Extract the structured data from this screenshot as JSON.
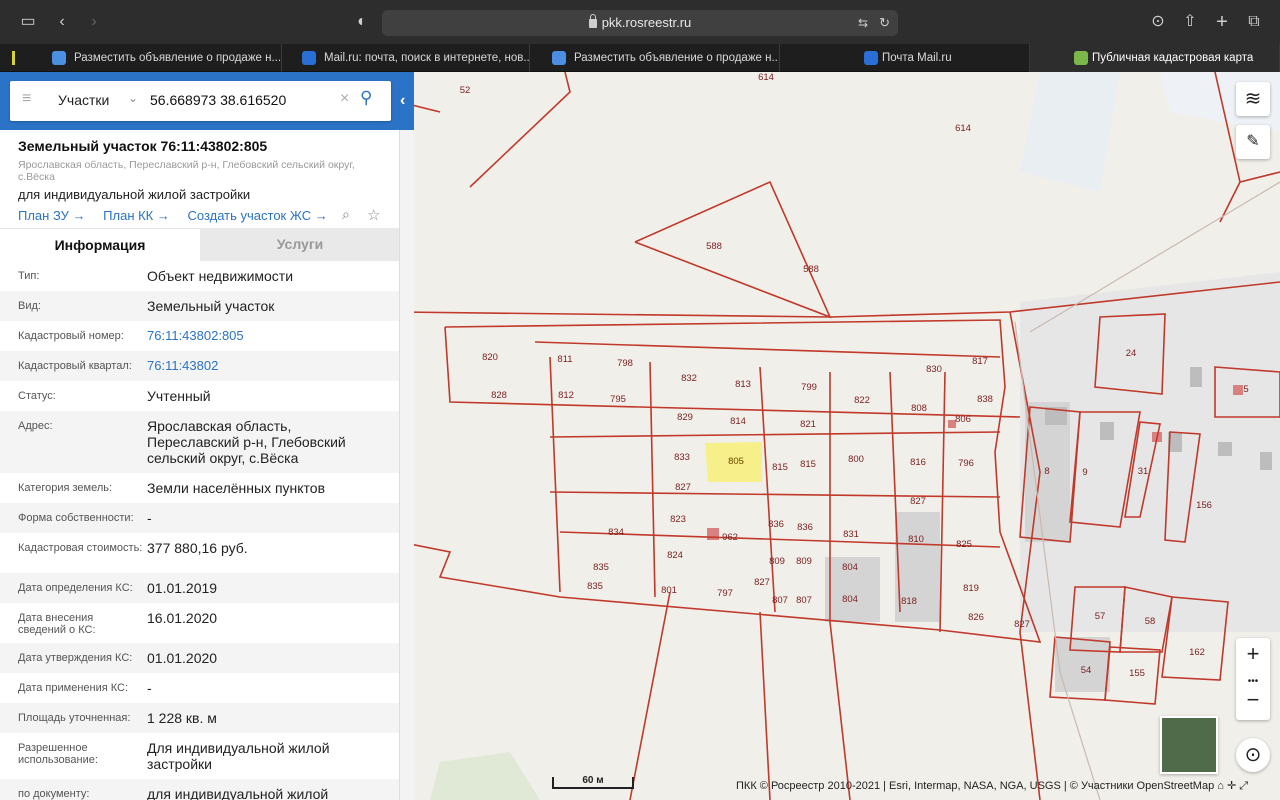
{
  "browser": {
    "url": "pkk.rosreestr.ru",
    "tabs": [
      {
        "title": "Разместить объявление о продаже н...",
        "active": false
      },
      {
        "title": "Mail.ru: почта, поиск в интернете, нов...",
        "active": false
      },
      {
        "title": "Разместить объявление о продаже н...",
        "active": false
      },
      {
        "title": "Почта Mail.ru",
        "active": false
      },
      {
        "title": "Публичная кадастровая карта",
        "active": true
      }
    ]
  },
  "search": {
    "type_label": "Участки",
    "query": "56.668973 38.616520"
  },
  "parcel": {
    "title": "Земельный участок 76:11:43802:805",
    "address_short": "Ярославская область, Переславский р-н, Глебовский сельский округ, с.Вёска",
    "purpose": "для индивидуальной жилой застройки",
    "links": [
      "План ЗУ →",
      "План КК →",
      "Создать участок ЖС →"
    ]
  },
  "info_tabs": [
    "Информация",
    "Услуги"
  ],
  "fields": [
    {
      "k": "Тип:",
      "v": "Объект недвижимости"
    },
    {
      "k": "Вид:",
      "v": "Земельный участок"
    },
    {
      "k": "Кадастровый номер:",
      "v": "76:11:43802:805",
      "link": true
    },
    {
      "k": "Кадастровый квартал:",
      "v": "76:11:43802",
      "link": true
    },
    {
      "k": "Статус:",
      "v": "Учтенный"
    },
    {
      "k": "Адрес:",
      "v": "Ярославская область, Переславский р-н, Глебовский сельский округ, с.Вёска"
    },
    {
      "k": "Категория земель:",
      "v": "Земли населённых пунктов"
    },
    {
      "k": "Форма собственности:",
      "v": "-"
    },
    {
      "k": "Кадастровая стоимость:",
      "v": "377 880,16 руб."
    },
    {
      "k": "Дата определения КС:",
      "v": "01.01.2019"
    },
    {
      "k": "Дата внесения сведений о КС:",
      "v": "16.01.2020"
    },
    {
      "k": "Дата утверждения КС:",
      "v": "01.01.2020"
    },
    {
      "k": "Дата применения КС:",
      "v": "-"
    },
    {
      "k": "Площадь уточненная:",
      "v": "1 228 кв. м"
    },
    {
      "k": "Разрешенное использование:",
      "v": "Для индивидуальной жилой застройки"
    },
    {
      "k": "по документу:",
      "v": "для индивидуальной жилой"
    }
  ],
  "map": {
    "scale_label": "60 м",
    "attribution": "ПКК © Росреестр 2010-2021 | Esri, Intermap, NASA, NGA, USGS | © Участники OpenStreetMap",
    "zoom_in": "+",
    "zoom_out": "−",
    "more": "•••",
    "highlight_color": "#f7f08a",
    "boundary_color": "#c0392b",
    "parcel_labels": [
      "614",
      "52",
      "614",
      "588",
      "588",
      "820",
      "811",
      "798",
      "832",
      "813",
      "799",
      "817",
      "830",
      "838",
      "828",
      "812",
      "795",
      "829",
      "814",
      "821",
      "822",
      "808",
      "806",
      "833",
      "805",
      "815",
      "815",
      "800",
      "816",
      "796",
      "827",
      "827",
      "834",
      "823",
      "962",
      "836",
      "836",
      "831",
      "810",
      "825",
      "824",
      "809",
      "809",
      "804",
      "835",
      "835",
      "801",
      "797",
      "827",
      "807",
      "807",
      "804",
      "818",
      "819",
      "826",
      "827",
      "24",
      "5",
      "8",
      "9",
      "31",
      "156",
      "57",
      "58",
      "162",
      "54",
      "155"
    ]
  }
}
